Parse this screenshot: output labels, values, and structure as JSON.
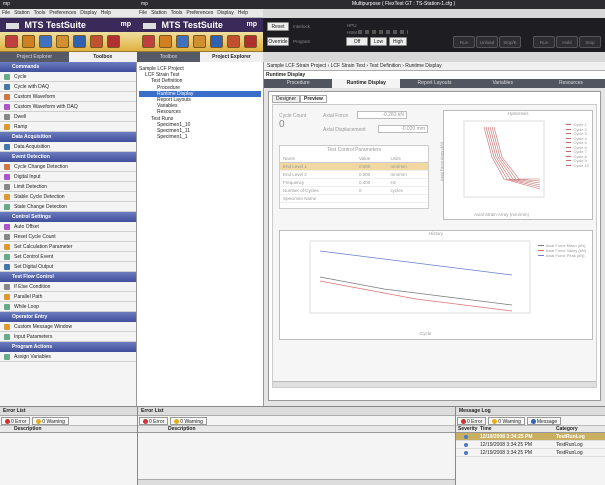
{
  "left_window": {
    "title_icon": "mp",
    "menu": [
      "File",
      "Station",
      "Tools",
      "Preferences",
      "Display",
      "Help"
    ],
    "brand": "MTS TestSuite",
    "brand_suffix": "mp",
    "tabs": [
      "Project Explorer",
      "Toolbox"
    ],
    "sections": [
      {
        "title": "Commands",
        "items": [
          "Cycle",
          "Cycle with DAQ",
          "Custom Waveform",
          "Custom Waveform with DAQ",
          "Dwell",
          "Ramp"
        ]
      },
      {
        "title": "Data Acquisition",
        "items": [
          "Data Acquisition"
        ]
      },
      {
        "title": "Event Detection",
        "items": [
          "Cycle Change Detection",
          "Digital Input",
          "Limit Detection",
          "Stable Cycle Detection",
          "State Change Detection"
        ]
      },
      {
        "title": "Control Settings",
        "items": [
          "Auto Offset",
          "Reset Cycle Count",
          "Set Calculation Parameter",
          "Set Control Event",
          "Set Digital Output"
        ]
      },
      {
        "title": "Test Flow Control",
        "items": [
          "If Else Condition",
          "Parallel Path",
          "While Loop"
        ]
      },
      {
        "title": "Operator Entry",
        "items": [
          "Custom Message Window",
          "Input Parameters"
        ]
      },
      {
        "title": "Program Actions",
        "items": [
          "Assign Variables"
        ]
      }
    ]
  },
  "right_window": {
    "title": "Multipurpose ( FlexTest GT : TS-Station-1.cfg )",
    "title_icon": "mp",
    "menu": [
      "File",
      "Station",
      "Tools",
      "Preferences",
      "Display",
      "Help"
    ],
    "brand": "MTS TestSuite",
    "brand_suffix": "mp",
    "tabs": [
      "Toolbox",
      "Project Explorer"
    ],
    "tree": [
      {
        "label": "Sample LCF Project",
        "indent": 0
      },
      {
        "label": "LCF Strain Test",
        "indent": 1
      },
      {
        "label": "Test Definition",
        "indent": 2
      },
      {
        "label": "Procedure",
        "indent": 3
      },
      {
        "label": "Runtime Display",
        "indent": 3,
        "selected": true
      },
      {
        "label": "Report Layouts",
        "indent": 3
      },
      {
        "label": "Variables",
        "indent": 3
      },
      {
        "label": "Resources",
        "indent": 3
      },
      {
        "label": "Test Runs",
        "indent": 2
      },
      {
        "label": "Specimen1_10",
        "indent": 3
      },
      {
        "label": "Specimen1_11",
        "indent": 3
      },
      {
        "label": "Specimen1_1",
        "indent": 3
      }
    ]
  },
  "control": {
    "reset": "Reset",
    "interlock": "Interlock",
    "override": "Override",
    "program": "Program",
    "off": "Off",
    "low": "Low",
    "high": "High",
    "hpu": "HPU",
    "hsm": "HSM",
    "actions": [
      "Run",
      "Unload",
      "Stop/E",
      "Run",
      "Hold",
      "Stop"
    ]
  },
  "breadcrumb": [
    "Sample LCF Strain Project",
    "LCF Strain Test",
    "Test Definition",
    "Runtime Display"
  ],
  "page_title": "Runtime Display",
  "doc_tabs": [
    "Procedure",
    "Runtime Display",
    "Report Layouts",
    "Variables",
    "Resources"
  ],
  "view_tabs": [
    "Designer",
    "Preview"
  ],
  "runtime": {
    "cycle_count_label": "Cycle Count",
    "cycle_count": "0",
    "axial_force_label": "Axial Force",
    "axial_force": "-0.283 kN",
    "axial_disp_label": "Axial Displacement",
    "axial_disp": "-0.020 mm",
    "params_title": "Test Control Parameters",
    "params_headers": [
      "Name",
      "Value",
      "Units"
    ],
    "params_rows": [
      [
        "End Level 1",
        "0.500",
        "mm/mm"
      ],
      [
        "End Level 2",
        "0.000",
        "mm/mm"
      ],
      [
        "Frequency",
        "0.400",
        "Hz"
      ],
      [
        "Number of Cycles",
        "0",
        "cycles"
      ],
      [
        "Specimen Name",
        "",
        ""
      ]
    ],
    "hyst_title": "Hysteresis",
    "hyst_xlabel": "Axial Strain Array (mm/mm)",
    "hyst_ylabel": "Axial Force Array (kN)",
    "hyst_legend": [
      "Cycle 1",
      "Cycle 2",
      "Cycle 3",
      "Cycle 4",
      "Cycle 5",
      "Cycle 6",
      "Cycle 7",
      "Cycle 8",
      "Cycle 9",
      "Cycle 10"
    ],
    "hist_title": "History",
    "hist_xlabel": "Cycle",
    "hist_ylabel": "Axial Force (kN)",
    "hist_legend": [
      "Axial Force Mean (kN)",
      "Axial Force Valley (kN)",
      "Axial Force Peak (kN)"
    ],
    "colors": {
      "peak": "#6a7fd0",
      "valley": "#e07070",
      "mean": "#7a7a7a",
      "hyst": "#c46a6a"
    }
  },
  "bottom": {
    "left_error_title": "Error List",
    "mid_error_title": "Error List",
    "msg_title": "Message Log",
    "errors_btn": "0 Error",
    "warn_btn": "0 Warning",
    "message_btn": "Message",
    "desc_header": "Description",
    "msg_headers": [
      "Severity",
      "Time",
      "Category"
    ],
    "msg_rows": [
      [
        "12/19/2008 3:34:25 PM",
        "TestRunLog"
      ],
      [
        "12/19/2008 3:34:25 PM",
        "TestRunLog"
      ],
      [
        "12/19/2008 3:34:25 PM",
        "TestRunLog"
      ]
    ]
  }
}
